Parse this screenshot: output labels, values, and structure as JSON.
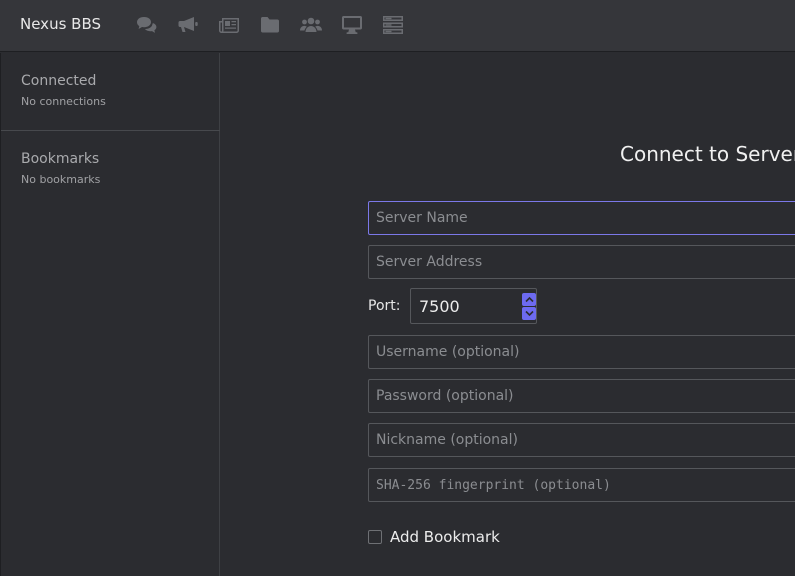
{
  "app": {
    "title": "Nexus BBS"
  },
  "toolbar": {
    "icons": [
      "chat-icon",
      "megaphone-icon",
      "newspaper-icon",
      "folder-icon",
      "users-icon",
      "monitor-icon",
      "server-icon"
    ]
  },
  "sidebar": {
    "connected": {
      "heading": "Connected",
      "empty": "No connections"
    },
    "bookmarks": {
      "heading": "Bookmarks",
      "empty": "No bookmarks"
    }
  },
  "form": {
    "title": "Connect to Server",
    "server_name": {
      "placeholder": "Server Name",
      "value": ""
    },
    "server_address": {
      "placeholder": "Server Address",
      "value": ""
    },
    "port": {
      "label": "Port:",
      "value": "7500"
    },
    "username": {
      "placeholder": "Username (optional)",
      "value": ""
    },
    "password": {
      "placeholder": "Password (optional)",
      "value": ""
    },
    "nickname": {
      "placeholder": "Nickname (optional)",
      "value": ""
    },
    "fingerprint": {
      "placeholder": "SHA-256 fingerprint (optional)",
      "value": ""
    },
    "add_bookmark": {
      "label": "Add Bookmark",
      "checked": false
    }
  },
  "colors": {
    "accent": "#6d6af0",
    "focus_border": "#7b78e8",
    "background": "#2b2c30",
    "topbar": "#35363a"
  }
}
